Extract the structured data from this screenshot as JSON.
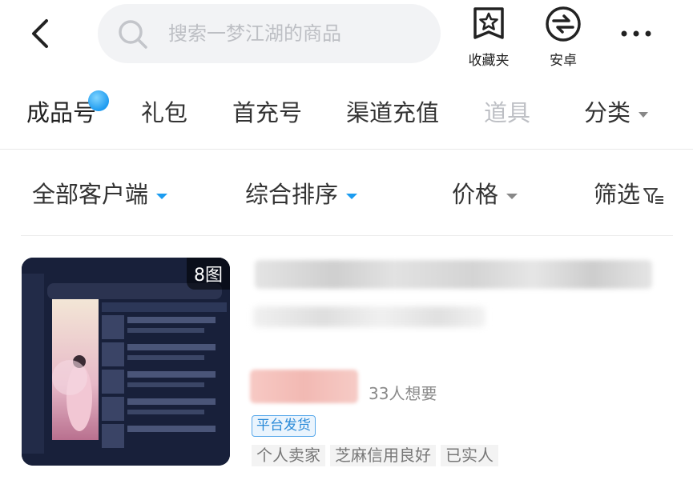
{
  "search": {
    "placeholder": "搜索一梦江湖的商品"
  },
  "header_actions": [
    {
      "id": "favorites",
      "label": "收藏夹",
      "icon": "star-box-icon"
    },
    {
      "id": "android",
      "label": "安卓",
      "icon": "android-circle-icon"
    }
  ],
  "tabs": [
    {
      "label": "成品号",
      "active": true
    },
    {
      "label": "礼包"
    },
    {
      "label": "首充号"
    },
    {
      "label": "渠道充值"
    },
    {
      "label": "道具"
    },
    {
      "label": "分类"
    }
  ],
  "filters": [
    {
      "label": "全部客户端"
    },
    {
      "label": "综合排序"
    },
    {
      "label": "价格"
    },
    {
      "label": "筛选"
    }
  ],
  "product": {
    "image_count": "8图",
    "want_count": "33人想要",
    "badge": "平台发货",
    "tags": [
      "个人卖家",
      "芝麻信用良好",
      "已实人"
    ]
  },
  "colors": {
    "accent": "#1c9cf0",
    "badge_border": "#58a8ea",
    "price_blur": "#f2b9b3"
  }
}
